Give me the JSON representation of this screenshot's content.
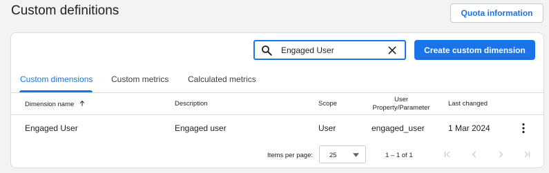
{
  "page": {
    "title": "Custom definitions",
    "quota_label": "Quota information"
  },
  "toolbar": {
    "search_value": "Engaged User",
    "create_label": "Create custom dimension"
  },
  "tabs": [
    {
      "label": "Custom dimensions",
      "active": true
    },
    {
      "label": "Custom metrics",
      "active": false
    },
    {
      "label": "Calculated metrics",
      "active": false
    }
  ],
  "table": {
    "headers": {
      "dimension_name": "Dimension name",
      "description": "Description",
      "scope": "Scope",
      "property_line1": "User",
      "property_line2": "Property/Parameter",
      "last_changed": "Last changed"
    },
    "rows": [
      {
        "dimension_name": "Engaged User",
        "description": "Engaged user",
        "scope": "User",
        "property": "engaged_user",
        "last_changed": "1 Mar 2024"
      }
    ]
  },
  "pagination": {
    "items_per_page_label": "Items per page:",
    "items_per_page_value": "25",
    "range_label": "1 – 1 of 1"
  },
  "colors": {
    "accent": "#1a73e8",
    "background": "#f1f3f4",
    "border": "#dadce0",
    "disabled_icon": "#c4c7c5"
  },
  "icons": [
    "search-icon",
    "close-icon",
    "arrow-upward-icon",
    "more-vert-icon",
    "dropdown-arrow-icon",
    "first-page-icon",
    "chevron-left-icon",
    "chevron-right-icon",
    "last-page-icon"
  ]
}
